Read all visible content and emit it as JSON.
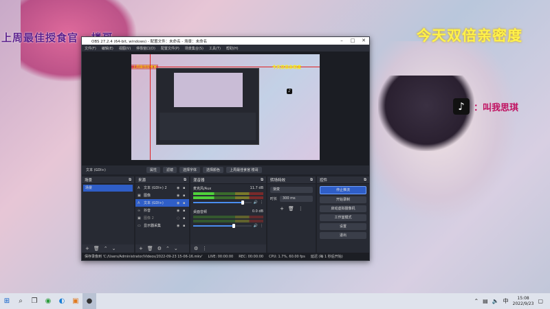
{
  "desktop": {
    "overlay_left": "上周最佳授食官 · 楼哥",
    "overlay_right": "今天双倍亲密度",
    "tiktok_text": "：叫我思琪",
    "tiktok_glyph": "♪"
  },
  "obs": {
    "title": "OBS 27.2.4 (64-bit, windows) - 配置文件：未命名 - 场景：未命名",
    "menu": [
      "文件(F)",
      "编辑(E)",
      "视图(V)",
      "停靠窗口(D)",
      "配置文件(P)",
      "场景集合(S)",
      "工具(T)",
      "帮助(H)"
    ],
    "preview_label": "上周最佳授食官",
    "preview_overlay": "今天双倍亲密度",
    "source_bar": {
      "name": "文本 (GDI+)",
      "buttons": [
        "属性",
        "滤镜",
        "选择字体",
        "选择颜色",
        "上周最佳食官 楼哥"
      ]
    },
    "scenes": {
      "title": "场景",
      "items": [
        {
          "label": "场景",
          "selected": true
        }
      ]
    },
    "sources": {
      "title": "来源",
      "items": [
        {
          "label": "文本 (GDI+) 2",
          "icon": "text-icon",
          "selected": false
        },
        {
          "label": "图像",
          "icon": "image-icon",
          "selected": false
        },
        {
          "label": "文本 (GDI+)",
          "icon": "text-icon",
          "selected": true
        },
        {
          "label": "抖音",
          "icon": "link-icon",
          "selected": false
        },
        {
          "label": "图像 2",
          "icon": "image-icon",
          "selected": false
        },
        {
          "label": "显示器采集",
          "icon": "monitor-icon",
          "selected": false
        }
      ]
    },
    "mixer": {
      "title": "混音器",
      "channels": [
        {
          "name": "麦克风/Aux",
          "db": "11.7 dB",
          "level": 0.3,
          "volume": 0.85
        },
        {
          "name": "桌面音频",
          "db": "0.0 dB",
          "level": 0,
          "volume": 0.7
        }
      ]
    },
    "transitions": {
      "title": "转场特效",
      "selected": "渐变",
      "duration_label": "时长",
      "duration": "300 ms"
    },
    "controls": {
      "title": "控件",
      "buttons": [
        {
          "label": "停止推流",
          "active": true
        },
        {
          "label": "开始录制",
          "active": false
        },
        {
          "label": "启动虚拟摄像机",
          "active": false
        },
        {
          "label": "工作室模式",
          "active": false
        },
        {
          "label": "设置",
          "active": false
        },
        {
          "label": "退出",
          "active": false
        }
      ]
    },
    "status": {
      "recording_path": "保存录像到 'C:/Users/Administrator/Videos/2022-09-23 15-06-16.mkv'",
      "live": "LIVE: 00:00:00",
      "rec": "REC: 00:00:00",
      "cpu": "CPU: 1.7%, 60.00 fps",
      "delay": "延迟 (每 1 秒后开始)"
    }
  },
  "taskbar": {
    "time": "15:08",
    "date": "2022/9/23",
    "lang": "中"
  },
  "colors": {
    "accent": "#2f5ec7",
    "yellow_text": "#fff24a",
    "purple_text": "#5b1f8c"
  }
}
